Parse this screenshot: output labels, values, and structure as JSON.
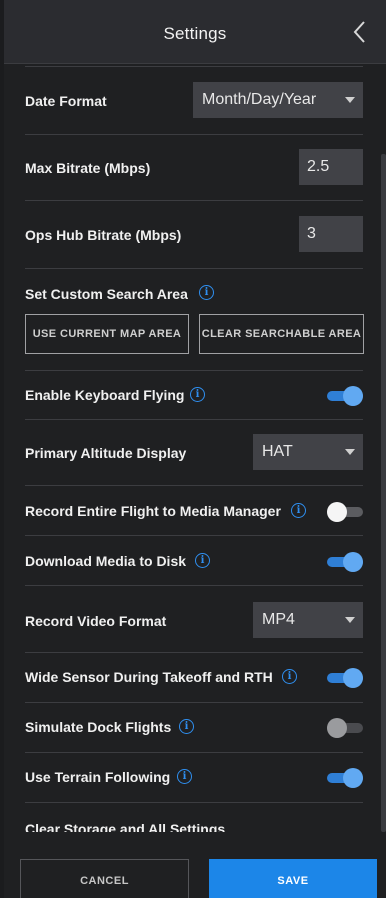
{
  "header": {
    "title": "Settings"
  },
  "settings": {
    "date_format": {
      "label": "Date Format",
      "value": "Month/Day/Year"
    },
    "max_bitrate": {
      "label": "Max Bitrate (Mbps)",
      "value": "2.5"
    },
    "ops_hub_bitrate": {
      "label": "Ops Hub Bitrate (Mbps)",
      "value": "3"
    },
    "custom_search_area": {
      "label": "Set Custom Search Area",
      "use_current_map_label": "USE CURRENT MAP AREA",
      "clear_searchable_label": "CLEAR SEARCHABLE AREA"
    },
    "keyboard_flying": {
      "label": "Enable Keyboard Flying",
      "enabled": true
    },
    "primary_altitude": {
      "label": "Primary Altitude Display",
      "value": "HAT"
    },
    "record_entire_flight": {
      "label": "Record Entire Flight to Media Manager",
      "enabled": false
    },
    "download_media": {
      "label": "Download Media to Disk",
      "enabled": true
    },
    "record_video_format": {
      "label": "Record Video Format",
      "value": "MP4"
    },
    "wide_sensor": {
      "label": "Wide Sensor During Takeoff and RTH",
      "enabled": true
    },
    "simulate_dock": {
      "label": "Simulate Dock Flights",
      "enabled": false,
      "disabled": true
    },
    "terrain_following": {
      "label": "Use Terrain Following",
      "enabled": true
    },
    "clear_storage": {
      "label": "Clear Storage and All Settings"
    }
  },
  "footer": {
    "cancel_label": "CANCEL",
    "save_label": "SAVE"
  },
  "colors": {
    "accent": "#1c86e8",
    "toggle_on": "#61a9f2",
    "background": "#1f2022"
  },
  "icons": {
    "back": "chevron-left-icon",
    "info": "info-icon",
    "dropdown": "caret-down-icon"
  }
}
